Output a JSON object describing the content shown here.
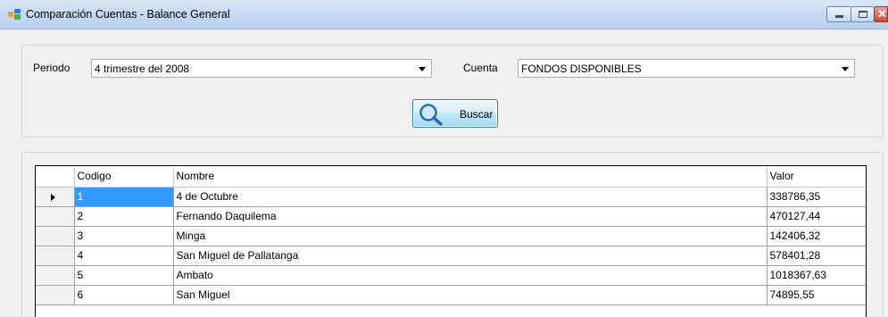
{
  "window": {
    "title": "Comparación Cuentas - Balance General",
    "controls": [
      "minimize-icon",
      "maximize-icon",
      "close-icon"
    ],
    "close_glyph": "✕"
  },
  "filters": {
    "periodo_label": "Periodo",
    "periodo_value": "4 trimestre del 2008",
    "cuenta_label": "Cuenta",
    "cuenta_value": "FONDOS DISPONIBLES",
    "buscar_label": "Buscar"
  },
  "grid": {
    "columns": [
      "Codigo",
      "Nombre",
      "Valor"
    ],
    "rows": [
      {
        "codigo": "1",
        "nombre": "4 de Octubre",
        "valor": "338786,35"
      },
      {
        "codigo": "2",
        "nombre": "Fernando Daquilema",
        "valor": "470127,44"
      },
      {
        "codigo": "3",
        "nombre": "Minga",
        "valor": "142406,32"
      },
      {
        "codigo": "4",
        "nombre": "San Miguel de Pallatanga",
        "valor": "578401,28"
      },
      {
        "codigo": "5",
        "nombre": "Ambato",
        "valor": "1018367,63"
      },
      {
        "codigo": "6",
        "nombre": "San Miguel",
        "valor": "74895,55"
      }
    ]
  },
  "colors": {
    "selection": "#3399ff",
    "titlebar": "#c6d9f1"
  }
}
